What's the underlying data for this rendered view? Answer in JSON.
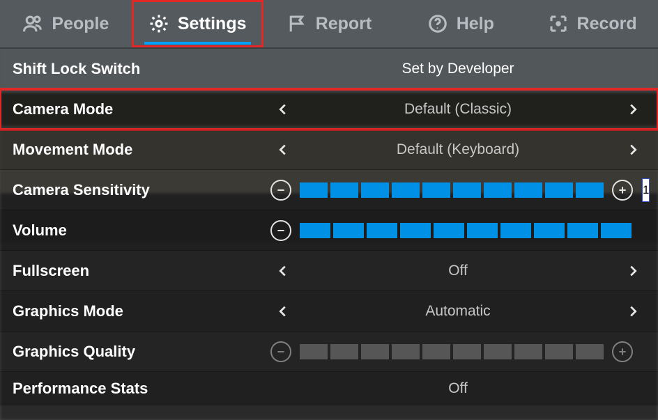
{
  "tabs": {
    "people": {
      "label": "People"
    },
    "settings": {
      "label": "Settings"
    },
    "report": {
      "label": "Report"
    },
    "help": {
      "label": "Help"
    },
    "record": {
      "label": "Record"
    }
  },
  "rows": {
    "shift_lock": {
      "label": "Shift Lock Switch",
      "value": "Set by Developer"
    },
    "camera_mode": {
      "label": "Camera Mode",
      "value": "Default (Classic)"
    },
    "movement": {
      "label": "Movement Mode",
      "value": "Default (Keyboard)"
    },
    "sensitivity": {
      "label": "Camera Sensitivity",
      "value": "1",
      "filled": 10,
      "total": 10
    },
    "volume": {
      "label": "Volume",
      "filled": 10,
      "total": 10
    },
    "fullscreen": {
      "label": "Fullscreen",
      "value": "Off"
    },
    "gmode": {
      "label": "Graphics Mode",
      "value": "Automatic"
    },
    "gquality": {
      "label": "Graphics Quality",
      "filled": 0,
      "total": 10
    },
    "perf": {
      "label": "Performance Stats",
      "value": "Off"
    }
  }
}
